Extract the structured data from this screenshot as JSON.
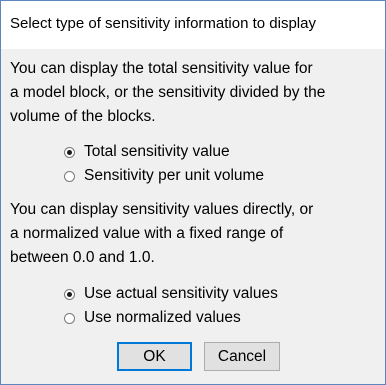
{
  "dialog": {
    "title": "Select type of sensitivity information to display"
  },
  "section1": {
    "lines": [
      "You can display the total sensitivity value for",
      "a model block, or the sensitivity divided by the",
      "volume of the blocks."
    ],
    "options": [
      {
        "label": "Total sensitivity value",
        "checked": true
      },
      {
        "label": "Sensitivity per unit volume",
        "checked": false
      }
    ]
  },
  "section2": {
    "lines": [
      "You can display sensitivity values directly, or",
      "a normalized value with a fixed range of",
      "between 0.0 and 1.0."
    ],
    "options": [
      {
        "label": "Use actual sensitivity values",
        "checked": true
      },
      {
        "label": "Use normalized values",
        "checked": false
      }
    ]
  },
  "buttons": {
    "ok_label": "OK",
    "cancel_label": "Cancel"
  }
}
